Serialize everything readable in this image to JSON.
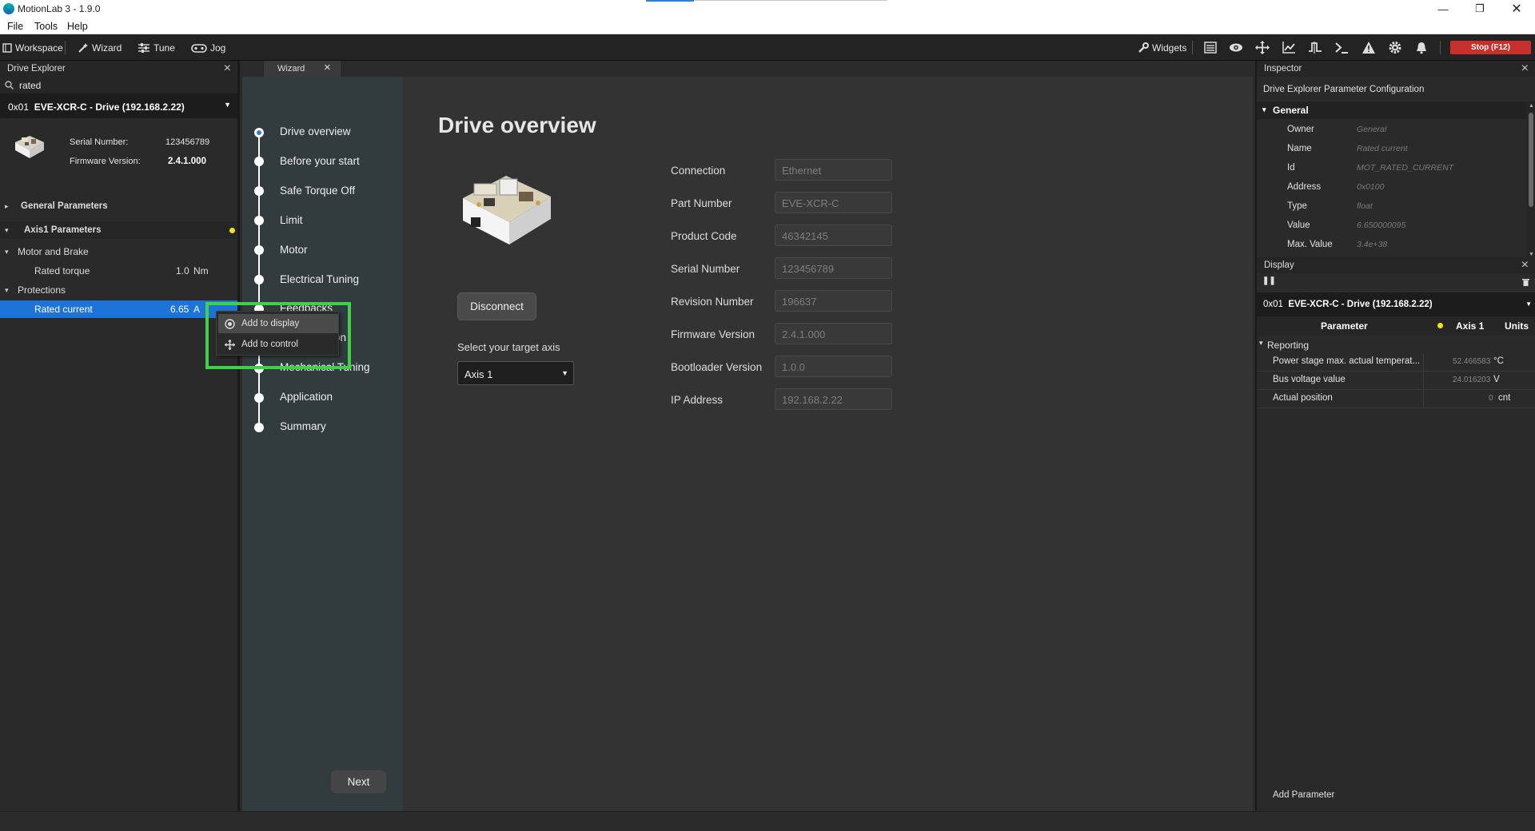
{
  "window": {
    "title": "MotionLab 3 - 1.9.0"
  },
  "menu": {
    "file": "File",
    "tools": "Tools",
    "help": "Help"
  },
  "toolbar": {
    "workspace": "Workspace",
    "wizard": "Wizard",
    "tune": "Tune",
    "jog": "Jog",
    "widgets": "Widgets",
    "stop": "Stop (F12)"
  },
  "drive_explorer": {
    "title": "Drive Explorer",
    "search_value": "rated",
    "drive_id": "0x01",
    "drive_name": "EVE-XCR-C - Drive (192.168.2.22)",
    "serial_label": "Serial Number:",
    "serial_value": "123456789",
    "firmware_label": "Firmware Version:",
    "firmware_value": "2.4.1.000",
    "general_params": "General Parameters",
    "axis1_params": "Axis1 Parameters",
    "motor_brake": "Motor and Brake",
    "rated_torque_label": "Rated torque",
    "rated_torque_value": "1.0",
    "rated_torque_unit": "Nm",
    "protections": "Protections",
    "rated_current_label": "Rated current",
    "rated_current_value": "6.65",
    "rated_current_unit": "A"
  },
  "context_menu": {
    "add_display": "Add to display",
    "add_control": "Add to control"
  },
  "wizard": {
    "tab": "Wizard",
    "steps": [
      "Drive overview",
      "Before your start",
      "Safe Torque Off",
      "Limit",
      "Motor",
      "Electrical Tuning",
      "Feedbacks",
      "Commutation",
      "Mechanical Tuning",
      "Application",
      "Summary"
    ],
    "visible_steps": {
      "s6": "Feedbacks",
      "s7": "on",
      "s8": "Mechanical Tuning"
    },
    "next": "Next"
  },
  "overview": {
    "title": "Drive overview",
    "disconnect": "Disconnect",
    "axis_prompt": "Select your target axis",
    "axis_value": "Axis 1",
    "fields": {
      "connection": {
        "label": "Connection",
        "value": "Ethernet"
      },
      "part": {
        "label": "Part Number",
        "value": "EVE-XCR-C"
      },
      "product": {
        "label": "Product Code",
        "value": "46342145"
      },
      "serial": {
        "label": "Serial Number",
        "value": "123456789"
      },
      "revision": {
        "label": "Revision Number",
        "value": "196637"
      },
      "firmware": {
        "label": "Firmware Version",
        "value": "2.4.1.000"
      },
      "bootloader": {
        "label": "Bootloader Version",
        "value": "1.0.0"
      },
      "ip": {
        "label": "IP Address",
        "value": "192.168.2.22"
      }
    }
  },
  "inspector": {
    "title": "Inspector",
    "subtitle": "Drive Explorer Parameter Configuration",
    "section": "General",
    "rows": {
      "owner": {
        "k": "Owner",
        "v": "General"
      },
      "name": {
        "k": "Name",
        "v": "Rated current"
      },
      "id": {
        "k": "Id",
        "v": "MOT_RATED_CURRENT"
      },
      "address": {
        "k": "Address",
        "v": "0x0100"
      },
      "type": {
        "k": "Type",
        "v": "float"
      },
      "value": {
        "k": "Value",
        "v": "6.650000095"
      },
      "maxvalue": {
        "k": "Max. Value",
        "v": "3.4e+38"
      }
    }
  },
  "display": {
    "title": "Display",
    "drive_id": "0x01",
    "drive_name": "EVE-XCR-C - Drive (192.168.2.22)",
    "col_param": "Parameter",
    "col_axis": "Axis 1",
    "col_units": "Units",
    "group": "Reporting",
    "rows": {
      "r1": {
        "name": "Power stage max. actual temperat...",
        "value": "52.466583",
        "unit": "°C"
      },
      "r2": {
        "name": "Bus voltage value",
        "value": "24.016203",
        "unit": "V"
      },
      "r3": {
        "name": "Actual position",
        "value": "0",
        "unit": "cnt"
      }
    },
    "add_parameter": "Add Parameter"
  },
  "colors": {
    "accent": "#2d7fd6",
    "selection": "#1e73d8",
    "stop": "#c8302b",
    "highlight": "#3cd24a",
    "indicator": "#f2e21b"
  }
}
